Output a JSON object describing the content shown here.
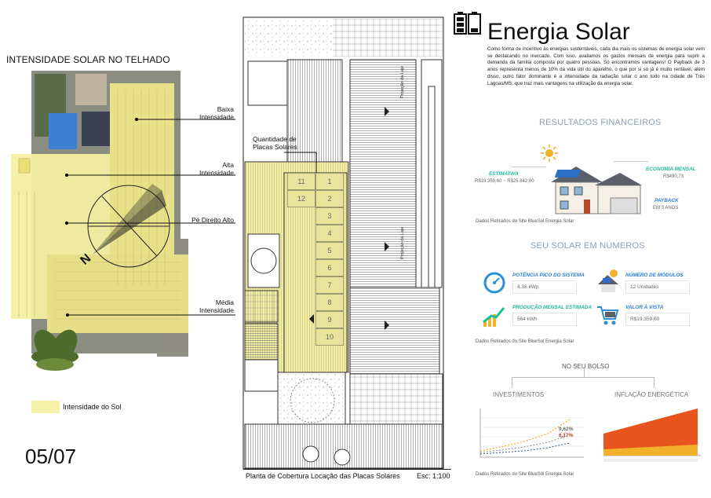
{
  "left": {
    "title": "INTENSIDADE SOLAR NO TELHADO",
    "callouts": {
      "baixa": [
        "Baixa",
        "Intensidade"
      ],
      "alta": [
        "Alta",
        "Intensidade"
      ],
      "pe_direito": "Pé Direito Alto",
      "media": [
        "Média",
        "Intensidade"
      ]
    },
    "compass_letter": "N",
    "legend_label": "Intensidade do Sol",
    "page_number": "05/07",
    "highlight_color": "#f4f1a8"
  },
  "plan": {
    "quantity_label": [
      "Quantidade de",
      "Placas Solares"
    ],
    "panel_numbers": [
      "1",
      "2",
      "3",
      "4",
      "5",
      "6",
      "7",
      "8",
      "9",
      "10",
      "11",
      "12"
    ],
    "wall_label_top": "Projeção da Laje",
    "wall_label_bottom": "Projeção da Laje",
    "caption": "Planta de Cobertura Locação das Placas Solares",
    "scale": "Esc: 1:100"
  },
  "right": {
    "title": "Energia Solar",
    "intro": "Como forma de incentivo às energias sustentáveis, cada dia mais os sistemas de energia solar vem se destacando no mercado. Com isso, avaliamos os gastos mensais de energia para suprir a demanda da família composta por quatro pessoas. Só encontramos vantagens! O Payback de 3 anos representa menos de 10% da vida útil do aparelho, o que por si só já é muito rentável, além disso, outro fator dominante é a intensidade da radiação solar o ano todo na cidade de Três Lagoas/MS, que traz mais vantagens na utilização da energia solar.",
    "financial": {
      "heading": "RESULTADOS FINANCEIROS",
      "estimativa_label": "ESTIMATIVA",
      "estimativa_value": "R$19.359,60 ~ R$25.842,00",
      "economia_label": "ECONOMIA MENSAL",
      "economia_value": "R$490,73",
      "payback_label": "PAYBACK",
      "payback_value": "EM 3 ANOS",
      "source": "Dados Retirados do Site BlueSol Energia Solar"
    },
    "numbers": {
      "heading": "SEU SOLAR EM NÚMEROS",
      "potencia_label": "POTÊNCIA PICO DO SISTEMA",
      "potencia_value": "4.38 kWp",
      "modulos_label": "NÚMERO DE MÓDULOS",
      "modulos_value": "12 Unidades",
      "producao_label": "PRODUÇÃO MENSAL ESTIMADA",
      "producao_value": "564 kWh",
      "valor_label": "VALOR À VISTA",
      "valor_value": "R$19.359,60",
      "source": "Dados Retirados do Site BlueSol Energia Solar"
    },
    "pocket": {
      "heading": "NO SEU BOLSO",
      "investimentos": "INVESTIMENTOS",
      "inflacao": "INFLAÇÃO ENERGÉTICA",
      "rates": [
        "9,62%",
        "6,17%"
      ],
      "source": "Dados Retirados do Site BlueSol Energia Solar"
    }
  }
}
